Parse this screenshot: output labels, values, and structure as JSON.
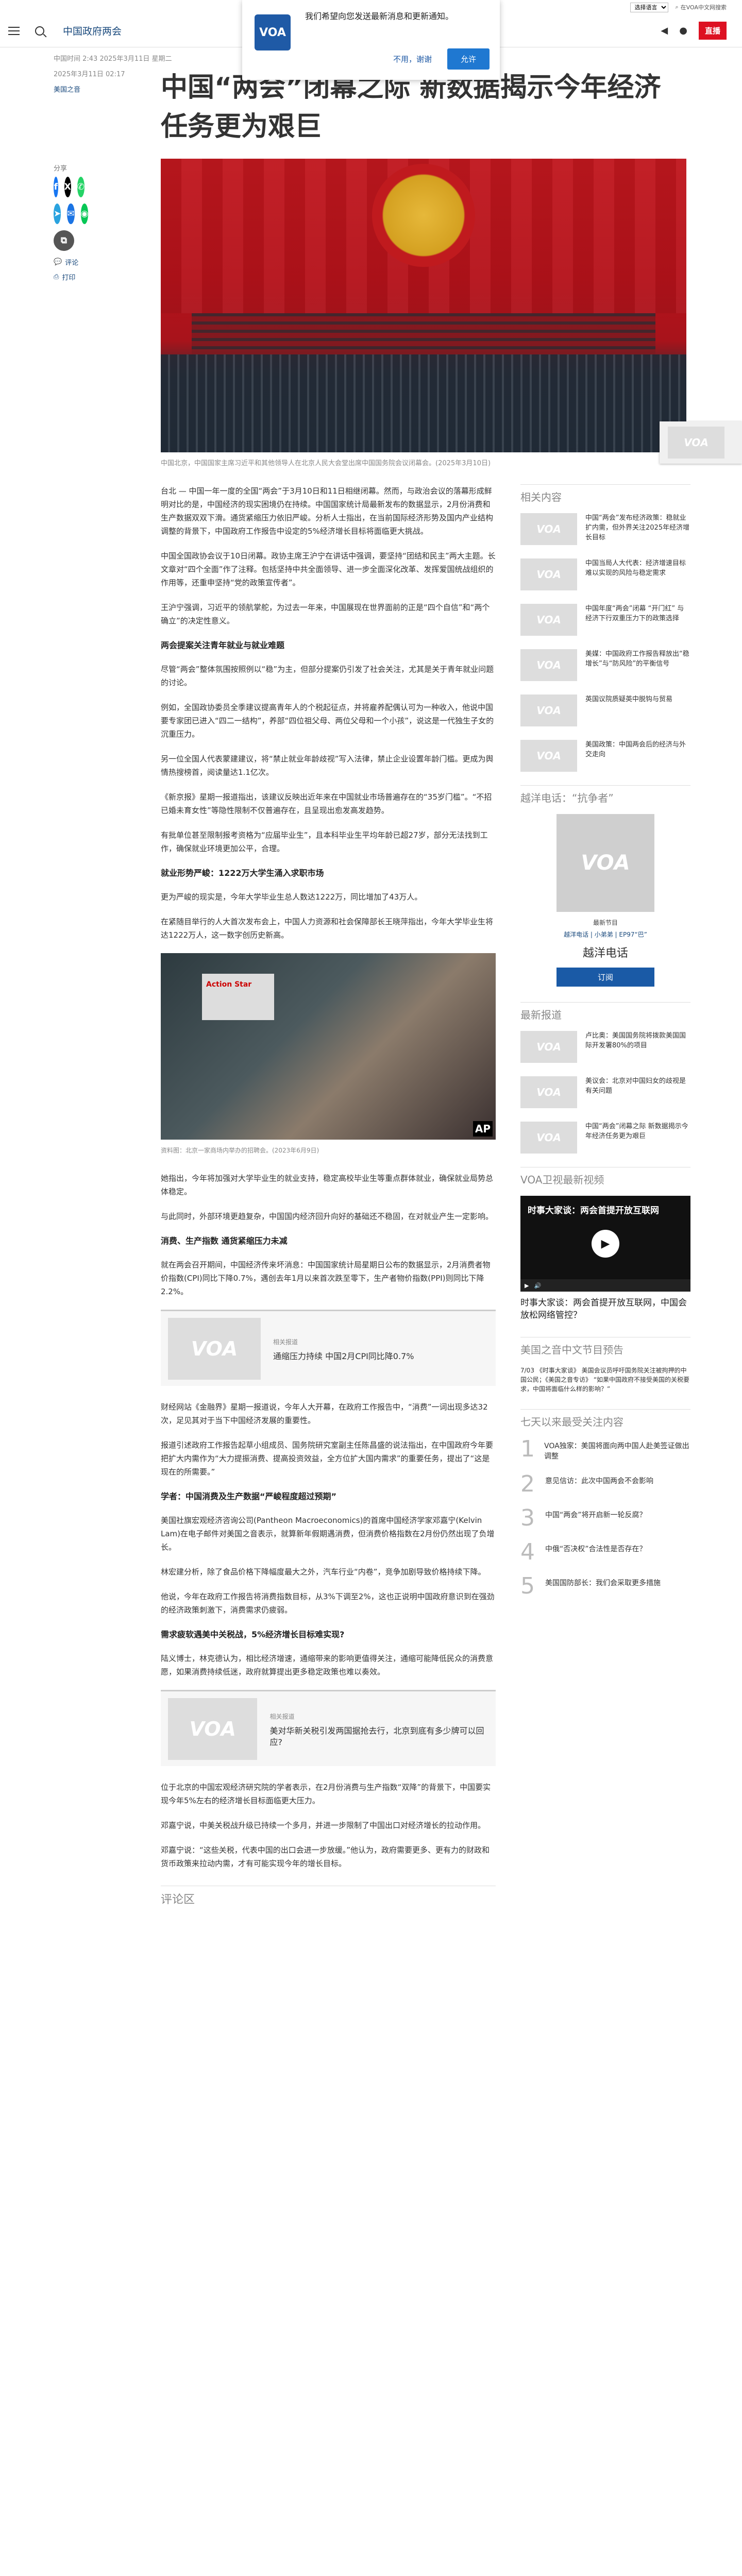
{
  "util": {
    "lang_select": "选择语言",
    "login": "登录",
    "search": "在VOA中文网搜索"
  },
  "header": {
    "brand": "中国政府两会",
    "live_label": "直播"
  },
  "notify": {
    "logo": "VOA",
    "text": "我们希望向您发送最新消息和更新通知。",
    "deny": "不用，谢谢",
    "allow": "允许"
  },
  "article": {
    "date": "中国时间 2:43 2025年3月11日 星期二",
    "updated": "2025年3月11日 02:17",
    "author": "美国之音",
    "title": "中国“两会”闭幕之际 新数据揭示今年经济任务更为艰巨",
    "hero_caption": "中国北京，中国国家主席习近平和其他领导人在北京人民大会堂出席中国国务院会议闭幕会。(2025年3月10日)",
    "paragraphs": [
      "台北 — 中国一年一度的全国“两会”于3月10日和11日相继闭幕。然而，与政治会议的落幕形成鲜明对比的是，中国经济的现实困境仍在持续。中国国家统计局最新发布的数据显示，2月份消费和生产数据双双下滑。通货紧缩压力依旧严峻。分析人士指出，在当前国际经济形势及国内产业结构调整的背景下，中国政府工作报告中设定的5%经济增长目标将面临更大挑战。",
      "中国全国政协会议于10日闭幕。政协主席王沪宁在讲话中强调，要坚持“团结和民主”两大主题。长文章对“四个全面”作了注释。包括坚持中共全面领导、进一步全面深化改革、发挥爱国统战组织的作用等，还重申坚持“党的政策宣传者”。",
      "王沪宁强调，习近平的领航掌舵，为过去一年来，中国展现在世界面前的正是“四个自信”和“两个确立”的决定性意义。"
    ],
    "h_employ": "两会提案关注青年就业与就业难题",
    "paragraphs2": [
      "尽管“两会”整体氛围按照例以“稳”为主，但部分提案仍引发了社会关注，尤其是关于青年就业问题的讨论。",
      "例如，全国政协委员全季建议提高青年人的个税起征点，并将雇养配偶认可为一种收入，他说中国要专家团已进入“四二一结构”，养部“四位祖父母、两位父母和一个小孩”，说这是一代独生子女的沉重压力。",
      "另一位全国人代表蒙建建议，将“禁止就业年龄歧视”写入法律，禁止企业设置年龄门槛。更成为舆情热搜榜首，阅读量达1.1亿次。",
      "《新京报》星期一报道指出，该建议反映出近年来在中国就业市场普遍存在的“35岁门槛”。“不招已婚未育女性”等隐性限制不仅普遍存在，且呈现出愈发高发趋势。",
      "有批单位甚至限制报考资格为“应届毕业生”，且本科毕业生平均年龄已超27岁，部分无法找到工作，确保就业环境更加公平，合理。"
    ],
    "h_grad": "就业形势严峻：1222万大学生涌入求职市场",
    "paragraphs3": [
      "更为严峻的现实是，今年大学毕业生总人数达1222万，同比增加了43万人。",
      "在紧随目举行的人大首次发布会上，中国人力资源和社会保障部长王晓萍指出，今年大学毕业生将达1222万人，这一数字创历史新高。"
    ],
    "photo2_caption": "资料图：北京一家商场内举办的招聘会。(2023年6月9日)",
    "photo2_sign": "Action Star",
    "photo2_credit": "AP",
    "paragraphs4": [
      "她指出，今年将加强对大学毕业生的就业支持，稳定高校毕业生等重点群体就业，确保就业局势总体稳定。",
      "与此同时，外部环境更趋复杂，中国国内经济回升向好的基础还不稳固，在对就业产生一定影响。"
    ],
    "h_cpi": "消费、生产指数 通货紧缩压力未减",
    "paragraphs5": [
      "就在两会召开期间，中国经济传来坏消息：中国国家统计局星期日公布的数据显示，2月消费者物价指数(CPI)同比下降0.7%，遇创去年1月以来首次跌至零下，生产者物价指数(PPI)则同比下降2.2%。"
    ],
    "embed1_label": "相关报道",
    "embed1_head": "通缩压力持续 中国2月CPI同比降0.7%",
    "paragraphs6": [
      "财经网站《金融界》星期一报道说，今年人大开幕，在政府工作报告中，“消费”一词出现多达32次，足见其对于当下中国经济发展的重要性。",
      "报道引述政府工作报告起草小组成员、国务院研究室副主任陈昌盛的说法指出，在中国政府今年要把扩大内需作为“大力提振消费、提高投资效益，全方位扩大国内需求”的重要任务，提出了“这是现在的所需要。”"
    ],
    "h_expert": "学者：中国消费及生产数据“严峻程度超过预期”",
    "paragraphs7": [
      "美国社旗宏观经济咨询公司(Pantheon Macroeconomics)的首席中国经济学家邓嘉宁(Kelvin Lam)在电子邮件对美国之音表示，就算新年假期遇消费，但消费价格指数在2月份仍然出现了负增长。",
      "林宏建分析，除了食品价格下降幅度最大之外，汽车行业“内卷”，竞争加剧导致价格持续下降。",
      "他说，今年在政府工作报告将消费指数目标，从3%下调至2%，这也正说明中国政府意识到在强劲的经济政策刺激下，消费需求仍疲弱。"
    ],
    "h_target": "需求疲软遇美中关税战，5%经济增长目标难实现?",
    "paragraphs8": [
      "陆义博士，林克德认为，相比经济增速，通缩带来的影响更值得关注，通缩可能降低民众的消费意愿，如果消费持续低迷，政府就算提出更多稳定政策也难以奏效。"
    ],
    "embed2_label": "相关报道",
    "embed2_head": "美对华新关税引发两国据抢去行，北京到底有多少牌可以回应?",
    "paragraphs9": [
      "位于北京的中国宏观经济研究院的学者表示，在2月份消费与生产指数“双降”的背景下，中国要实现今年5%左右的经济增长目标面临更大压力。",
      "邓嘉宁说，中美关税战升级已持续一个多月，并进一步限制了中国出口对经济增长的拉动作用。",
      "邓嘉宁说：“这些关税，代表中国的出口会进一步放缓。”他认为，政府需要更多、更有力的财政和货币政策来拉动内需，才有可能实现今年的增长目标。"
    ],
    "comments_label": "评论区"
  },
  "share": {
    "label": "分享",
    "comments": "评论",
    "print": "打印"
  },
  "sidebar": {
    "related_title": "相关内容",
    "related": [
      "中国“两会”发布经济政策：稳就业扩内需，但外界关注2025年经济增长目标",
      "中国当局人大代表：经济增速目标难以实现的风险与稳定需求",
      "中国年度“两会”闭幕 “开门红” 与经济下行双重压力下的政策选择",
      "美媒：中国政府工作报告释放出“稳增长”与“防风险”的平衡信号",
      "英国议院质疑英中脱钩与贸易",
      "美国政策：中国两会后的经济与外交走向"
    ],
    "promo_title": "越洋电话：“抗争者”",
    "promo_line1": "最新节目",
    "promo_line2": "越洋电话 | 小弟弟 | EP97“巴”",
    "promo_name": "越洋电话",
    "promo_btn": "订阅",
    "latest_title": "最新报道",
    "latest": [
      "卢比奥：美国国务院将拨款美国国际开发署80%的项目",
      "美议会：北京对中国妇女的歧视是有关问题",
      "中国“两会”闭幕之际 新数据揭示今年经济任务更为艰巨"
    ],
    "video_section": "VOA卫视最新视频",
    "video_title": "时事大家谈：两会首提开放互联网",
    "video_caption": "时事大家谈：两会首提开放互联网，中国会放松网络管控？",
    "sched_title": "美国之音中文节目预告",
    "sched_text": "7/03 《时事大家谈》 美国会议员呼吁国务院关注被拘押的中国公民；《美国之音专访》 “如果中国政府不接受美国的关税要求，中国将面临什么样的影响？”",
    "top7_title": "七天以来最受关注内容",
    "top7": [
      "VOA独家：美国将面向两中国人赴美签证做出调整",
      "意见信访：此次中国两会不会影响",
      "中国“两会”将开启新一轮反腐？",
      "中俄“否决权”合法性是否存在？",
      "美国国防部长：我们会采取更多措施"
    ],
    "float_logo": "VOA"
  },
  "logo_text": "VOA"
}
